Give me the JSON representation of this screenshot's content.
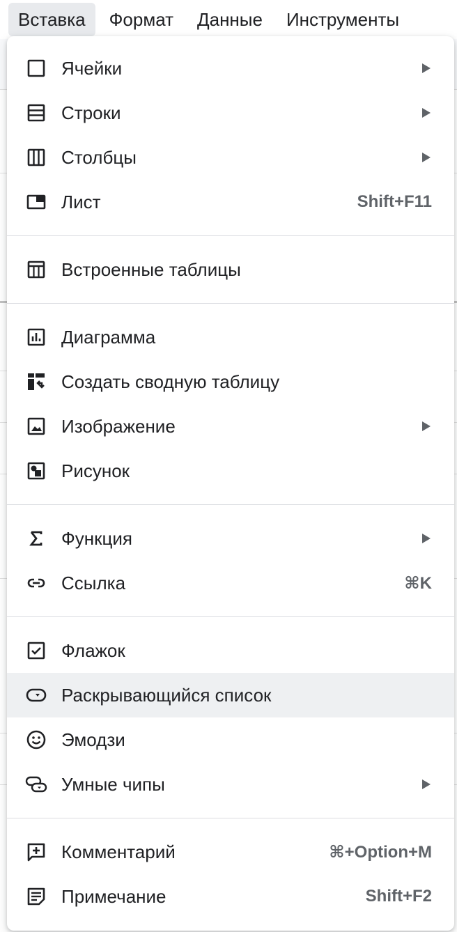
{
  "menubar": {
    "items": [
      "Вставка",
      "Формат",
      "Данные",
      "Инструменты"
    ]
  },
  "menu": {
    "cells": {
      "label": "Ячейки",
      "icon": "cell-icon"
    },
    "rows": {
      "label": "Строки",
      "icon": "rows-icon"
    },
    "columns": {
      "label": "Столбцы",
      "icon": "columns-icon"
    },
    "sheet": {
      "label": "Лист",
      "icon": "sheet-icon",
      "shortcut": "Shift+F11"
    },
    "tables": {
      "label": "Встроенные таблицы",
      "icon": "table-icon"
    },
    "chart": {
      "label": "Диаграмма",
      "icon": "chart-icon"
    },
    "pivot": {
      "label": "Создать сводную таблицу",
      "icon": "pivot-table-icon"
    },
    "image": {
      "label": "Изображение",
      "icon": "image-icon"
    },
    "drawing": {
      "label": "Рисунок",
      "icon": "drawing-icon"
    },
    "function": {
      "label": "Функция",
      "icon": "sigma-icon"
    },
    "link": {
      "label": "Ссылка",
      "icon": "link-icon",
      "shortcut": "⌘K"
    },
    "checkbox": {
      "label": "Флажок",
      "icon": "checkbox-icon"
    },
    "dropdown": {
      "label": "Раскрывающийся список",
      "icon": "dropdown-icon"
    },
    "emoji": {
      "label": "Эмодзи",
      "icon": "emoji-icon"
    },
    "smart_chips": {
      "label": "Умные чипы",
      "icon": "smart-chips-icon"
    },
    "comment": {
      "label": "Комментарий",
      "icon": "comment-icon",
      "shortcut": "⌘+Option+M"
    },
    "note": {
      "label": "Примечание",
      "icon": "note-icon",
      "shortcut": "Shift+F2"
    }
  },
  "colors": {
    "hover": "#eef0f2",
    "text": "#202124",
    "muted": "#5f6368"
  }
}
